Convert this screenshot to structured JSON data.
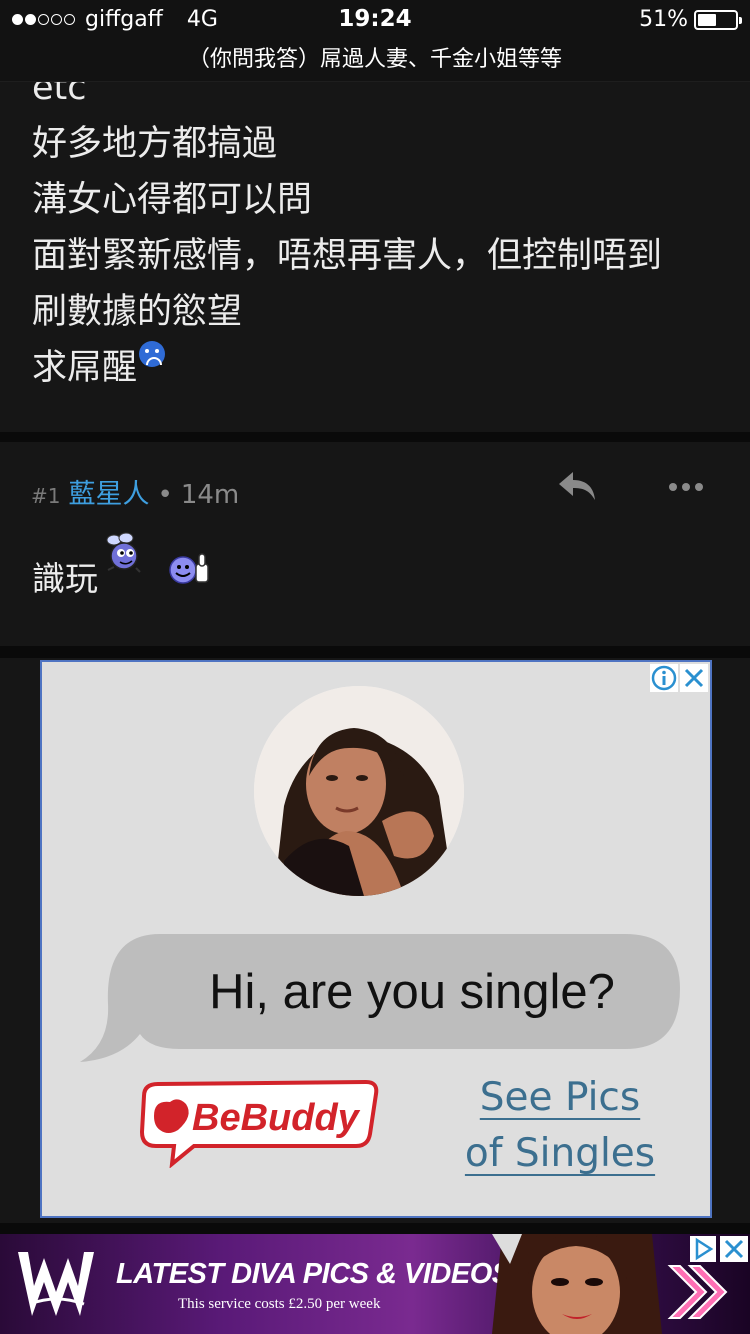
{
  "status_bar": {
    "carrier": "giffgaff",
    "network": "4G",
    "time": "19:24",
    "battery": "51%",
    "battery_level": 0.51,
    "signal_bars": 2
  },
  "title_bar": {
    "title": "（你問我答）屌過人妻、千金小姐等等"
  },
  "post": {
    "lines": [
      "etc",
      "好多地方都搞過",
      "溝女心得都可以問",
      "面對緊新感情，唔想再害人，但控制唔到",
      "刷數據的慾望",
      "求屌醒"
    ],
    "emoji": "sad-face-icon"
  },
  "reply": {
    "number": "#1",
    "user": "藍星人",
    "separator": "•",
    "time": "14m",
    "text": "識玩",
    "emojis": [
      "bee-icon",
      "thumbs-up-smiley-icon"
    ]
  },
  "ad": {
    "headline": "Hi, are you single?",
    "brand": "BeBuddy",
    "cta_lines": [
      "See Pics",
      "of Singles"
    ],
    "colors": {
      "brand_red": "#d2232a",
      "link": "#3c6f8f",
      "border": "#4f74c2"
    }
  },
  "banner": {
    "title": "LATEST DIVA PICS & VIDEOS",
    "subtitle": "This service costs £2.50 per week",
    "brand_logo": "wwe-logo"
  },
  "colors": {
    "background": "#161616",
    "username": "#3e9fe0",
    "text": "#ececec"
  }
}
